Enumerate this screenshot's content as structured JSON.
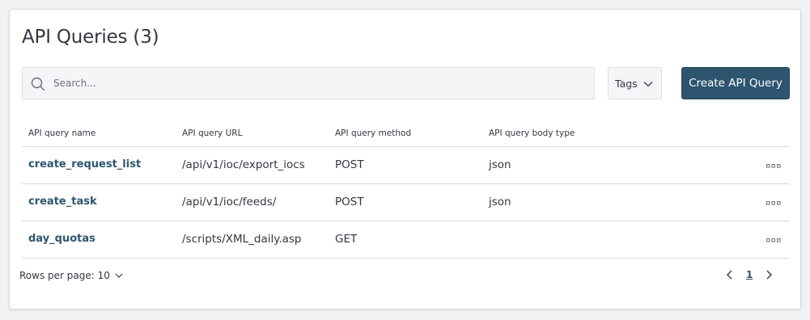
{
  "header": {
    "title": "API Queries (3)"
  },
  "search": {
    "placeholder": "Search..."
  },
  "tags_button": {
    "label": "Tags"
  },
  "create_button": {
    "label": "Create API Query"
  },
  "table": {
    "columns": [
      "API query name",
      "API query URL",
      "API query method",
      "API query body type"
    ],
    "rows": [
      {
        "name": "create_request_list",
        "url": "/api/v1/ioc/export_iocs",
        "method": "POST",
        "body_type": "json"
      },
      {
        "name": "create_task",
        "url": "/api/v1/ioc/feeds/",
        "method": "POST",
        "body_type": "json"
      },
      {
        "name": "day_quotas",
        "url": "/scripts/XML_daily.asp",
        "method": "GET",
        "body_type": ""
      }
    ]
  },
  "footer": {
    "rows_per_page": "Rows per page: 10",
    "current_page": "1"
  },
  "colors": {
    "accent": "#2e5570",
    "text": "#343741",
    "border": "#d3dae6",
    "background": "#f1f2f4"
  }
}
